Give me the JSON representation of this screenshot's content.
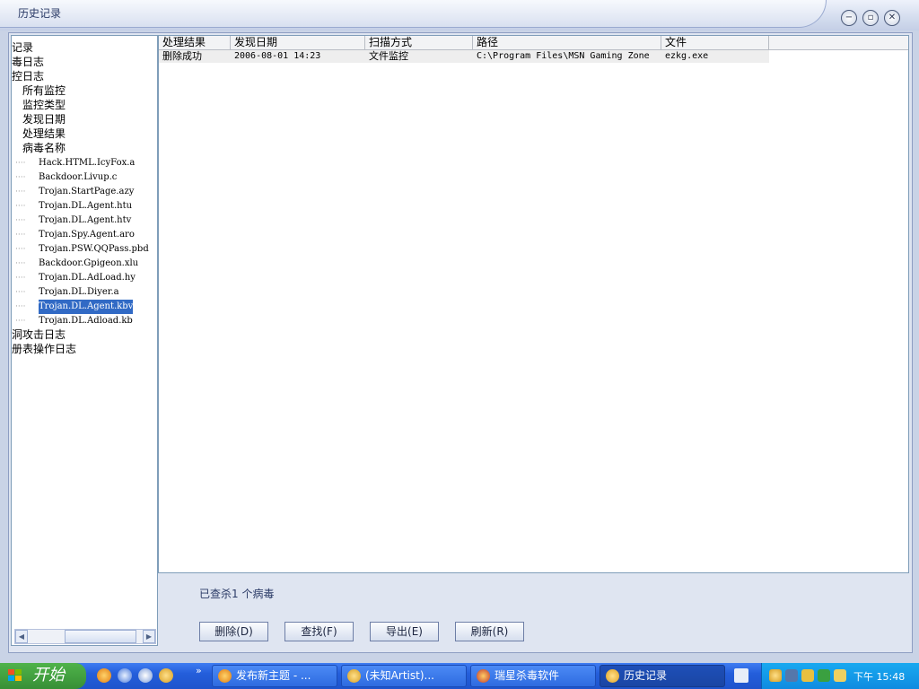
{
  "window": {
    "title": "历史记录"
  },
  "tree": {
    "items": [
      {
        "label": "记录"
      },
      {
        "label": "毒日志"
      },
      {
        "label": "控日志"
      },
      {
        "label": "所有监控"
      },
      {
        "label": "监控类型"
      },
      {
        "label": "发现日期"
      },
      {
        "label": "处理结果"
      },
      {
        "label": "病毒名称"
      }
    ],
    "viruses": [
      "Hack.HTML.IcyFox.a",
      "Backdoor.Livup.c",
      "Trojan.StartPage.azy",
      "Trojan.DL.Agent.htu",
      "Trojan.DL.Agent.htv",
      "Trojan.Spy.Agent.aro",
      "Trojan.PSW.QQPass.pbd",
      "Backdoor.Gpigeon.xlu",
      "Trojan.DL.AdLoad.hy",
      "Trojan.DL.Diyer.a",
      "Trojan.DL.Agent.kbv",
      "Trojan.DL.Adload.kb"
    ],
    "selected_index": 10,
    "tail": [
      "洞攻击日志",
      "册表操作日志"
    ]
  },
  "table": {
    "columns": [
      "处理结果",
      "发现日期",
      "扫描方式",
      "路径",
      "文件"
    ],
    "rows": [
      [
        "删除成功",
        "2006-08-01 14:23",
        "文件监控",
        "C:\\Program Files\\MSN Gaming Zone",
        "ezkg.exe"
      ]
    ]
  },
  "status": "已查杀1 个病毒",
  "actions": {
    "delete": "删除(D)",
    "find": "查找(F)",
    "export": "导出(E)",
    "refresh": "刷新(R)"
  },
  "taskbar": {
    "start": "开始",
    "overflow": "»",
    "tasks": [
      "发布新主题 - ...",
      "(未知Artist)...",
      "瑞星杀毒软件",
      "历史记录"
    ],
    "clock": "下午 15:48"
  }
}
